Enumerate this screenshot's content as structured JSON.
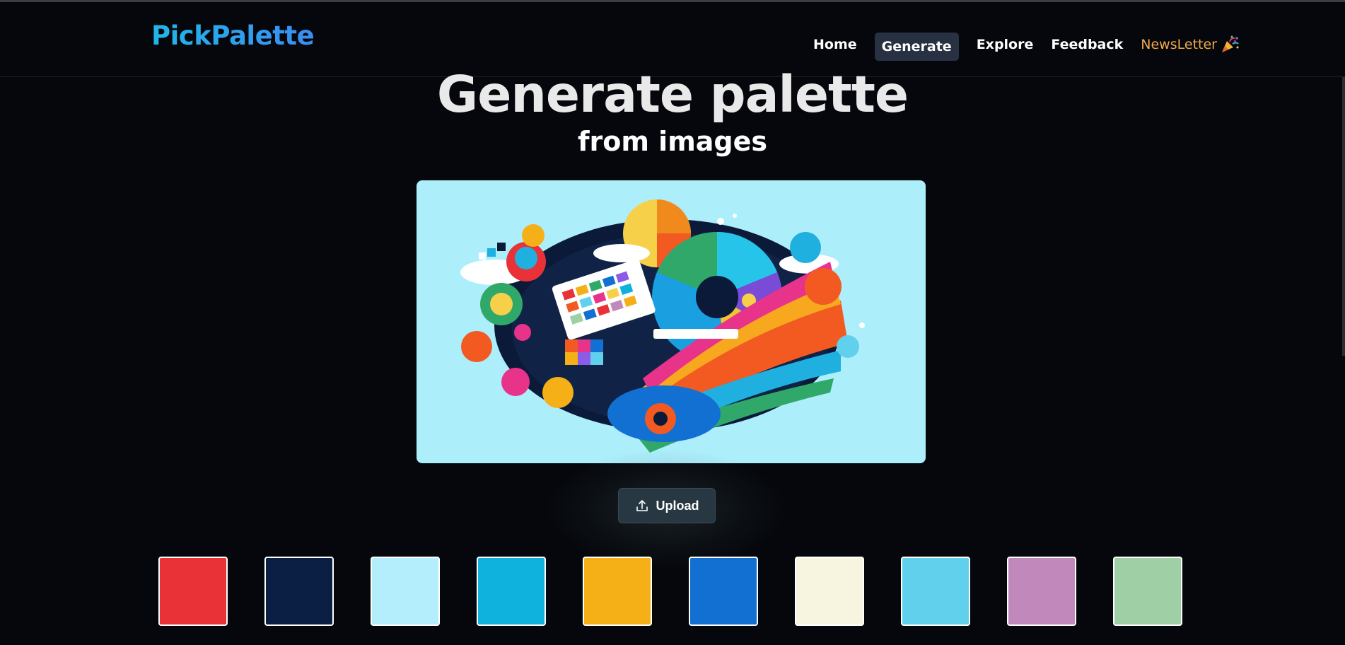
{
  "brand": {
    "name": "PickPalette"
  },
  "nav": {
    "items": [
      {
        "label": "Home",
        "active": false
      },
      {
        "label": "Generate",
        "active": true
      },
      {
        "label": "Explore",
        "active": false
      },
      {
        "label": "Feedback",
        "active": false
      },
      {
        "label": "NewsLetter",
        "active": false,
        "icon": "party-popper-icon",
        "color": "#f0a94a"
      }
    ]
  },
  "hero": {
    "title": "Generate palette",
    "subtitle": "from images"
  },
  "upload": {
    "label": "Upload",
    "icon": "upload-icon"
  },
  "palette": {
    "swatches": [
      "#e83237",
      "#0b1f45",
      "#b4edfb",
      "#0fb2dd",
      "#f6b017",
      "#1270d2",
      "#f7f4e0",
      "#61d0ec",
      "#c189bb",
      "#9fd0a5"
    ]
  },
  "colors": {
    "background": "#05070c",
    "active_nav_bg": "#283142",
    "image_bg": "#adeefb",
    "accent_blue": "#20b6e8"
  }
}
